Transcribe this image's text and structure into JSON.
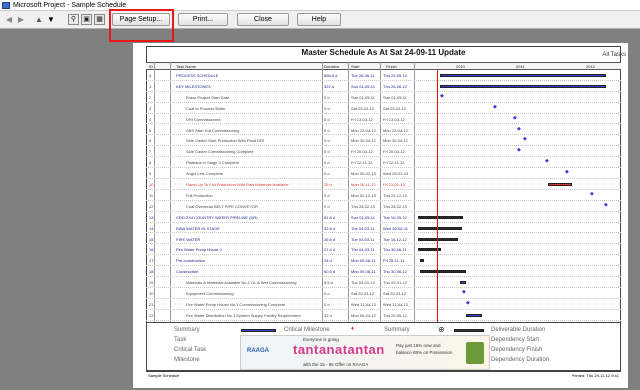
{
  "window": {
    "title": "Microsoft Project - Sample Schedule"
  },
  "toolbar": {
    "buttons": [
      {
        "label": "Page Setup..."
      },
      {
        "label": "Print..."
      },
      {
        "label": "Close"
      },
      {
        "label": "Help"
      }
    ],
    "icons": [
      "first-page-icon",
      "previous-page-icon",
      "previous-page-alt-icon",
      "next-page-icon",
      "zoom-icon",
      "one-page-icon",
      "multi-page-icon"
    ]
  },
  "report": {
    "title": "Master Schedule As At Sat 24-09-11  Update",
    "tasks_label": "All Tasks",
    "columns": {
      "id": "ID",
      "i": "",
      "name": "Task Name",
      "duration": "Duration",
      "start": "Start",
      "finish": "Finish"
    },
    "timeline_years": [
      "2010",
      "2011",
      "2012"
    ],
    "rows": [
      {
        "id": "0",
        "name": "PROCESS SCHEDULE",
        "duration": "856.5 d",
        "start": "Tue 26-06-11",
        "finish": "Thu 29-05-12",
        "style": "summary"
      },
      {
        "id": "1",
        "name": "KEY MILESTONES",
        "duration": "322 d",
        "start": "Sun 01-05-11",
        "finish": "Thu 26-06-12",
        "style": "summary"
      },
      {
        "id": "2",
        "name": "Erase Project Start Date",
        "duration": "0 d",
        "start": "Sun 01-05-11",
        "finish": "Sun 01-05-11",
        "style": "task"
      },
      {
        "id": "3",
        "name": "Coal to Process Boiler",
        "duration": "0 d",
        "start": "Sat 03-03-12",
        "finish": "Sat 03-03-12",
        "style": "task"
      },
      {
        "id": "4",
        "name": "DRI Commissioned",
        "duration": "0 d",
        "start": "Fri 13-04-12",
        "finish": "Fri 13-04-12",
        "style": "task"
      },
      {
        "id": "5",
        "name": "SBS Start Hot Commissioning",
        "duration": "0 d",
        "start": "Mon 22-04-12",
        "finish": "Mon 22-04-12",
        "style": "task"
      },
      {
        "id": "6",
        "name": "Side Caster Start Production With Plant DRI",
        "duration": "0 d",
        "start": "Mon 30-04-12",
        "finish": "Mon 30-04-12",
        "style": "task"
      },
      {
        "id": "7",
        "name": "Side Caster Commissioning Complete",
        "duration": "0 d",
        "start": "Fri 20-04-12",
        "finish": "Fri 20-04-12",
        "style": "task"
      },
      {
        "id": "8",
        "name": "Plateaus in Stage 3 Complete",
        "duration": "0 d",
        "start": "Fri 22-11-12",
        "finish": "Fri 22-11-12",
        "style": "task"
      },
      {
        "id": "9",
        "name": "Angul Link Complete",
        "duration": "0 d",
        "start": "Mon 05-02-13",
        "finish": "Wed 05-02-13",
        "style": "task"
      },
      {
        "id": "10",
        "name": "Ramp Up To Full Production With Raw Materials Available",
        "duration": "25 d",
        "start": "Mon 26-11-12",
        "finish": "Fri 21-01-13",
        "style": "critical"
      },
      {
        "id": "11",
        "name": "Full Production",
        "duration": "0 d",
        "start": "Mon 02-12-13",
        "finish": "Thu 22-12-13",
        "style": "task"
      },
      {
        "id": "12",
        "name": "Coal Overhead BELT PIPE CONVEYOR",
        "duration": "0 d",
        "start": "Thu 28-02-13",
        "finish": "Thu 28-02-13",
        "style": "task"
      },
      {
        "id": "13",
        "name": "CRD-2X4 COUNTRY WATER PIPELINE (DR)",
        "duration": "81.8 d",
        "start": "Sun 01-05-11",
        "finish": "Tue 10-05-12",
        "style": "summary"
      },
      {
        "id": "14",
        "name": "RAW WATER IN STAGE",
        "duration": "32.8 d",
        "start": "Tue 04-03-11",
        "finish": "Wed 30-06-11",
        "style": "summary"
      },
      {
        "id": "15",
        "name": "FIRE WATER",
        "duration": "26.6 d",
        "start": "Tue 04-03-11",
        "finish": "Tue 16-12-12",
        "style": "summary"
      },
      {
        "id": "16",
        "name": "Fire Water Pump House 1",
        "duration": "21.4 d",
        "start": "Thu 04-03-11",
        "finish": "Thu 30-06-11",
        "style": "summary"
      },
      {
        "id": "17",
        "name": "Pre-construction",
        "duration": "24 d",
        "start": "Mon 09-06-11",
        "finish": "Fri 25-11-11",
        "style": "summary"
      },
      {
        "id": "18",
        "name": "Construction",
        "duration": "60.5 d",
        "start": "Mon 09-06-11",
        "finish": "Thu 30-06-12",
        "style": "summary"
      },
      {
        "id": "19",
        "name": "Materials & Materials Available No.1 DL & Wet Commissioning",
        "duration": "5.5 d",
        "start": "Tue 03-01-12",
        "finish": "Thu 09-01-12",
        "style": "task"
      },
      {
        "id": "20",
        "name": "Equipment Commissioning",
        "duration": "0 d",
        "start": "Sat 20-03-12",
        "finish": "Sat 20-03-12",
        "style": "task"
      },
      {
        "id": "21",
        "name": "Fire Water Pump House No.1 Commissioning Complete",
        "duration": "0 d",
        "start": "Wed 11-04-12",
        "finish": "Wed 11-04-12",
        "style": "task"
      },
      {
        "id": "22",
        "name": "Fire Water Distribution No.1 System Supply Facility Requirement",
        "duration": "32 d",
        "start": "Mon 06-04-12",
        "finish": "Thu 20-05-12",
        "style": "task"
      }
    ],
    "legend": {
      "summary": "Summary",
      "critical_milestone": "Critical Milestone",
      "summary2": "Summary",
      "deliverable_duration": "Deliverable Duration",
      "task": "Task",
      "dependency_start": "Dependency Start",
      "critical_task": "Critical Task",
      "dependency_finish": "Dependency Finish",
      "milestone": "Milestone",
      "dependency_duration": "Dependency Duration"
    },
    "ad": {
      "headline": "tantanatantan",
      "brand": "RAAGA",
      "tagline": "Everyone is going",
      "offer1": "Pay just 15% now and",
      "offer2": "balance 85% on Possession",
      "offer3": "with the 15 - 85 Offer on RAAGA"
    },
    "footer": {
      "left": "Sample Schedule",
      "right": "Printed: Thu 29-11-12 9:41"
    }
  },
  "colors": {
    "summary_bar": "#3c3cd6",
    "critical_bar": "#e03030",
    "task_bar": "#3c3cd6",
    "deliverable_bar": "#333333",
    "today_line": "#d11111",
    "highlight_box": "#e41a1a"
  }
}
